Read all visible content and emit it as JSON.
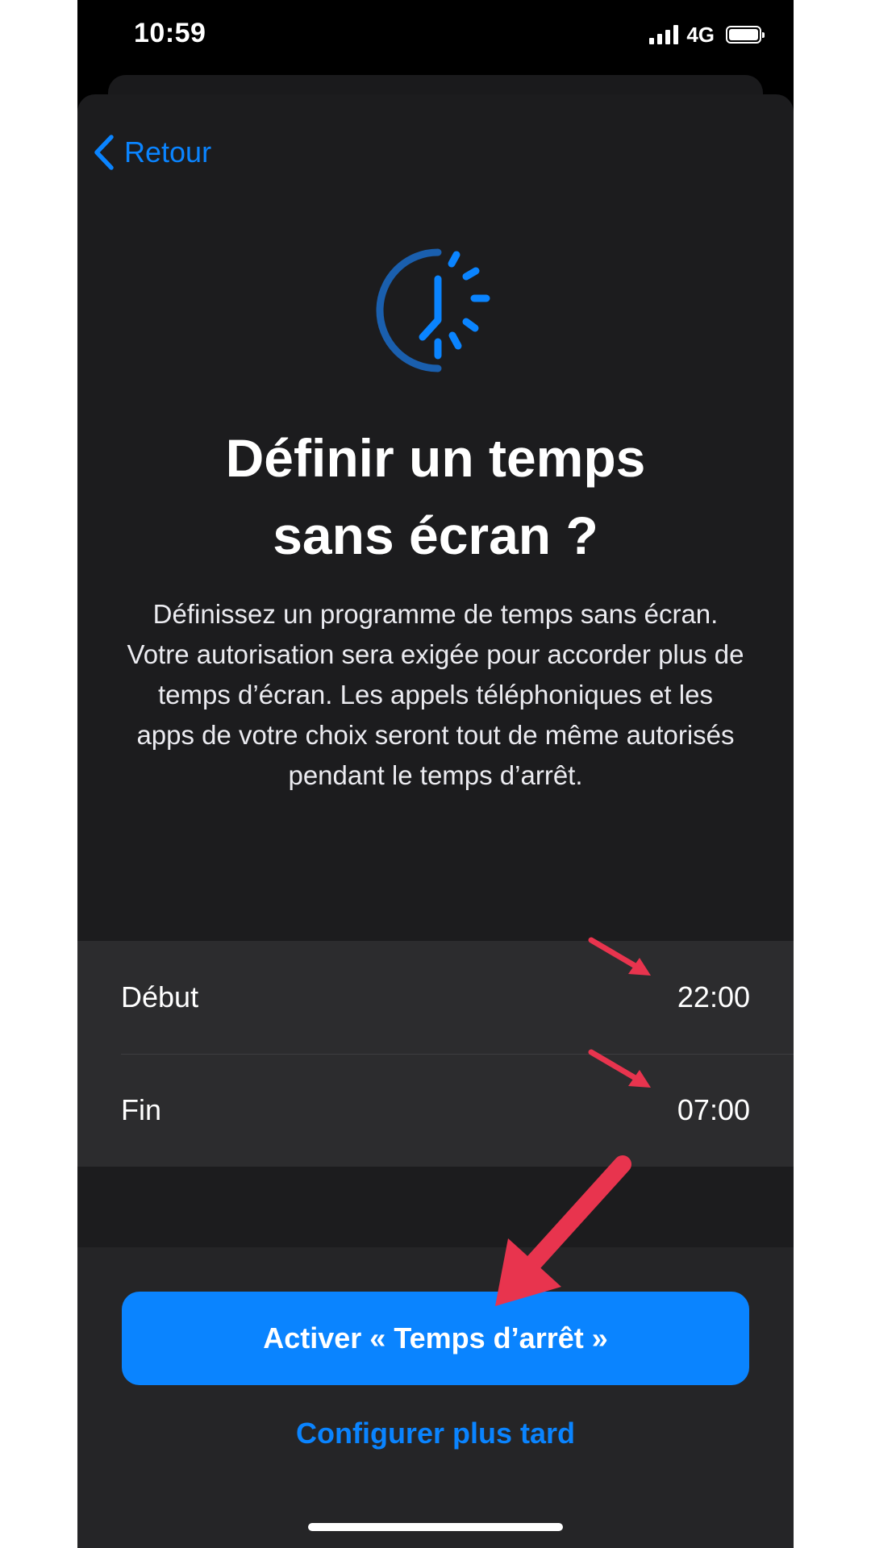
{
  "status_bar": {
    "time": "10:59",
    "network": "4G",
    "signal_bars": 4,
    "battery_level": 1.0
  },
  "navigation": {
    "back_label": "Retour",
    "back_icon": "chevron-left-icon"
  },
  "hero": {
    "icon": "downtime-clock-icon",
    "title_line1": "Définir un temps",
    "title_line2": "sans écran ?",
    "description": "Définissez un programme de temps sans écran. Votre autorisation sera exigée pour accorder plus de temps d’écran. Les appels téléphoniques et les apps de votre choix seront tout de même autorisés pendant le temps d’arrêt."
  },
  "schedule": {
    "start_label": "Début",
    "start_value": "22:00",
    "end_label": "Fin",
    "end_value": "07:00"
  },
  "actions": {
    "primary_label": "Activer « Temps d’arrêt »",
    "secondary_label": "Configurer plus tard"
  },
  "colors": {
    "accent": "#0a84ff",
    "sheet_background": "#1c1c1e",
    "row_background": "#2c2c2e",
    "annotation_arrow": "#e8344e"
  }
}
